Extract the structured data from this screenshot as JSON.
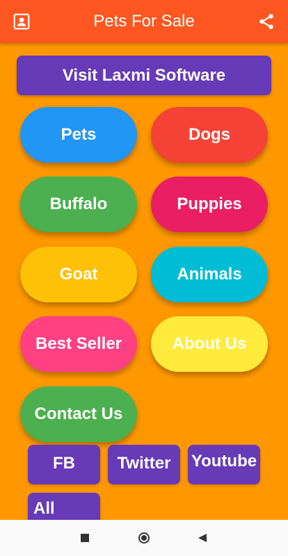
{
  "appbar": {
    "title": "Pets For Sale",
    "left_icon": "contact-card-icon",
    "right_icon": "share-icon",
    "color": "#ff5722"
  },
  "background_color": "#ff9800",
  "visit_button": {
    "label": "Visit Laxmi Software",
    "color": "#673ab7"
  },
  "categories": [
    {
      "label": "Pets",
      "color": "#2196f3"
    },
    {
      "label": "Dogs",
      "color": "#f44336"
    },
    {
      "label": "Buffalo",
      "color": "#4caf50"
    },
    {
      "label": "Puppies",
      "color": "#e91e63"
    },
    {
      "label": "Goat",
      "color": "#ffc107"
    },
    {
      "label": "Animals",
      "color": "#00bcd4"
    },
    {
      "label": "Best Seller",
      "color": "#ff4081"
    },
    {
      "label": "About Us",
      "color": "#ffeb3b"
    },
    {
      "label": "Contact Us",
      "color": "#4caf50"
    }
  ],
  "social_buttons": [
    {
      "label": "FB"
    },
    {
      "label": "Twitter"
    },
    {
      "label": "Youtube"
    },
    {
      "label": "All"
    }
  ],
  "navbar": {
    "icons": [
      "recent-apps-icon",
      "home-icon",
      "back-icon"
    ]
  }
}
